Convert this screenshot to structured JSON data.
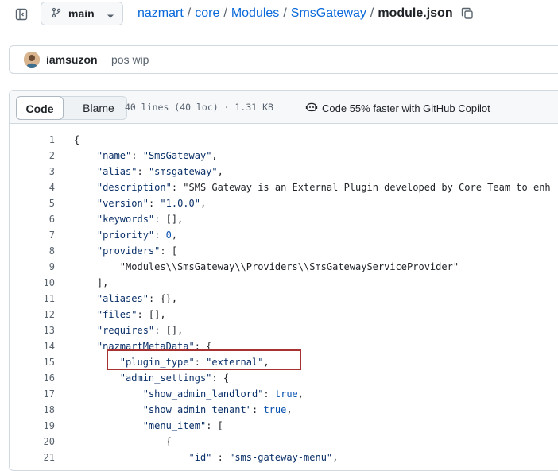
{
  "branch": {
    "name": "main"
  },
  "breadcrumb": {
    "owner": "nazmart",
    "p1": "core",
    "p2": "Modules",
    "p3": "SmsGateway",
    "file": "module.json",
    "sep": "/"
  },
  "commit": {
    "author": "iamsuzon",
    "message": "pos wip"
  },
  "file": {
    "tab_code": "Code",
    "tab_blame": "Blame",
    "info": "40 lines (40 loc) · 1.31 KB",
    "copilot": "Code 55% faster with GitHub Copilot"
  },
  "lines": [
    {
      "n": "1",
      "text": "{"
    },
    {
      "n": "2",
      "text": "    \"name\": \"SmsGateway\","
    },
    {
      "n": "3",
      "text": "    \"alias\": \"smsgateway\","
    },
    {
      "n": "4",
      "text": "    \"description\": \"SMS Gateway is an External Plugin developed by Core Team to enh"
    },
    {
      "n": "5",
      "text": "    \"version\": \"1.0.0\","
    },
    {
      "n": "6",
      "text": "    \"keywords\": [],"
    },
    {
      "n": "7",
      "text": "    \"priority\": 0,"
    },
    {
      "n": "8",
      "text": "    \"providers\": ["
    },
    {
      "n": "9",
      "text": "        \"Modules\\\\SmsGateway\\\\Providers\\\\SmsGatewayServiceProvider\""
    },
    {
      "n": "10",
      "text": "    ],"
    },
    {
      "n": "11",
      "text": "    \"aliases\": {},"
    },
    {
      "n": "12",
      "text": "    \"files\": [],"
    },
    {
      "n": "13",
      "text": "    \"requires\": [],"
    },
    {
      "n": "14",
      "text": "    \"nazmartMetaData\": {"
    },
    {
      "n": "15",
      "text": "        \"plugin_type\": \"external\","
    },
    {
      "n": "16",
      "text": "        \"admin_settings\": {"
    },
    {
      "n": "17",
      "text": "            \"show_admin_landlord\": true,"
    },
    {
      "n": "18",
      "text": "            \"show_admin_tenant\": true,"
    },
    {
      "n": "19",
      "text": "            \"menu_item\": ["
    },
    {
      "n": "20",
      "text": "                {"
    },
    {
      "n": "21",
      "text": "                    \"id\" : \"sms-gateway-menu\","
    }
  ],
  "colors": {
    "link": "#0969da",
    "highlight": "#a83232"
  }
}
